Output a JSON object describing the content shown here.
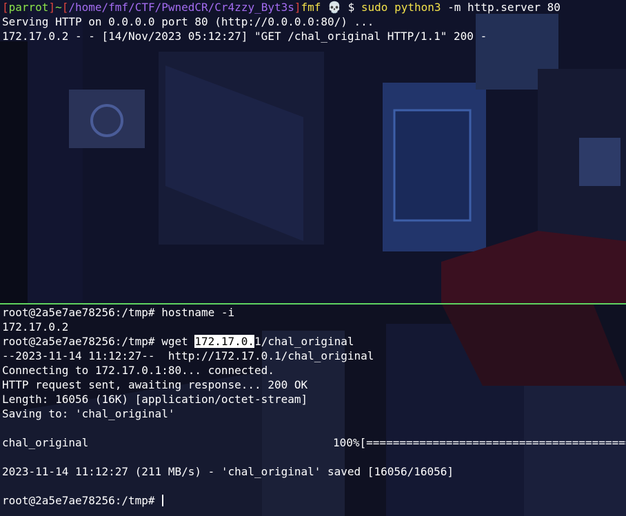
{
  "top_pane": {
    "prompt": {
      "open_bracket": "[",
      "user": "parrot",
      "close_bracket": "]",
      "tilde": "~",
      "path_open": "[",
      "path": "/home/fmf/CTF/PwnedCR/Cr4zzy_Byt3s",
      "path_close": "]",
      "host": "fmf",
      "skull": "💀",
      "dollar": "$",
      "sudo": "sudo",
      "cmd": "python3",
      "args": " -m http.server 80"
    },
    "lines": [
      "Serving HTTP on 0.0.0.0 port 80 (http://0.0.0.0:80/) ...",
      "172.17.0.2 - - [14/Nov/2023 05:12:27] \"GET /chal_original HTTP/1.1\" 200 -"
    ]
  },
  "bottom_pane": {
    "prompt": "root@2a5e7ae78256:/tmp#",
    "cmd1": " hostname -i",
    "out1": "172.17.0.2",
    "cmd2_pre": " wget ",
    "cmd2_selected": "172.17.0.",
    "cmd2_post": "1/chal_original",
    "lines": [
      "--2023-11-14 11:12:27--  http://172.17.0.1/chal_original",
      "Connecting to 172.17.0.1:80... connected.",
      "HTTP request sent, awaiting response... 200 OK",
      "Length: 16056 (16K) [application/octet-stream]",
      "Saving to: 'chal_original'"
    ],
    "progress": {
      "file": "chal_original",
      "percent": "100%",
      "bar": "[============================================",
      "fraction": 1.0
    },
    "saved_line": "2023-11-14 11:12:27 (211 MB/s) - 'chal_original' saved [16056/16056]",
    "final_prompt": "root@2a5e7ae78256:/tmp#"
  },
  "colors": {
    "divider": "#5fd35f",
    "prompt_red": "#e0453c",
    "prompt_green": "#8be34a",
    "path_purple": "#a36cf0",
    "cmd_yellow": "#f2e14a"
  }
}
